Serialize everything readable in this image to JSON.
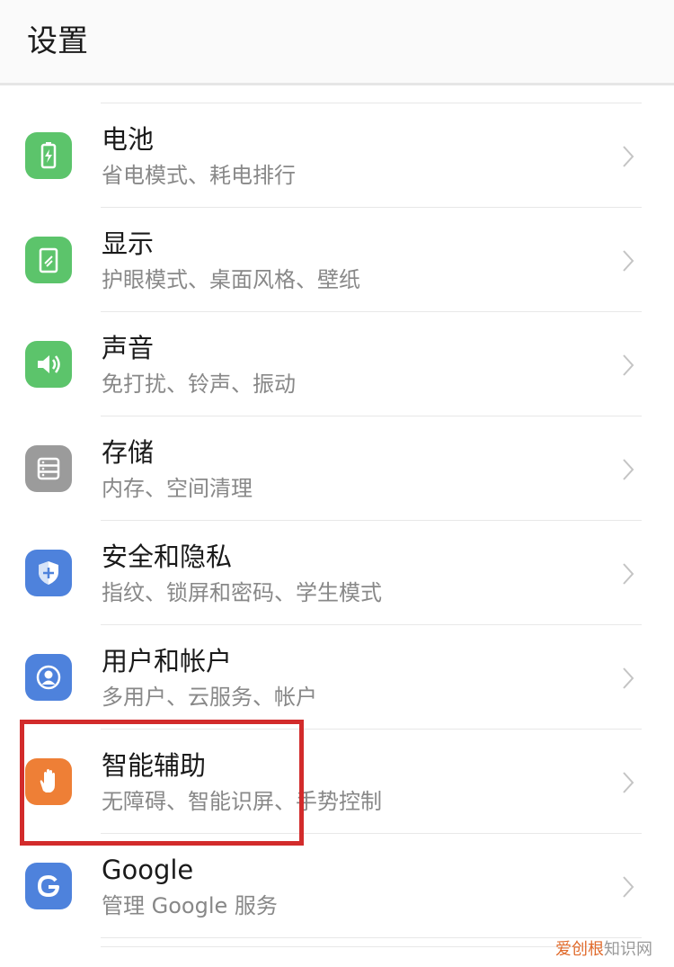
{
  "header": {
    "title": "设置"
  },
  "settings": [
    {
      "label": "电池",
      "sub": "省电模式、耗电排行",
      "icon": "battery-icon",
      "color": "#5cc46b"
    },
    {
      "label": "显示",
      "sub": "护眼模式、桌面风格、壁纸",
      "icon": "display-icon",
      "color": "#5cc46b"
    },
    {
      "label": "声音",
      "sub": "免打扰、铃声、振动",
      "icon": "sound-icon",
      "color": "#5cc46b"
    },
    {
      "label": "存储",
      "sub": "内存、空间清理",
      "icon": "storage-icon",
      "color": "#9b9b9b"
    },
    {
      "label": "安全和隐私",
      "sub": "指纹、锁屏和密码、学生模式",
      "icon": "shield-icon",
      "color": "#4e82dc"
    },
    {
      "label": "用户和帐户",
      "sub": "多用户、云服务、帐户",
      "icon": "user-icon",
      "color": "#4e82dc"
    },
    {
      "label": "智能辅助",
      "sub": "无障碍、智能识屏、手势控制",
      "icon": "hand-icon",
      "color": "#ee7f36"
    },
    {
      "label": "Google",
      "sub": "管理 Google 服务",
      "icon": "google-icon",
      "color": "#4e82dc"
    }
  ],
  "highlight": {
    "target": "智能辅助",
    "color": "#d22b2b"
  },
  "watermark": {
    "part1": "爱创根",
    "part2": "知识网"
  }
}
